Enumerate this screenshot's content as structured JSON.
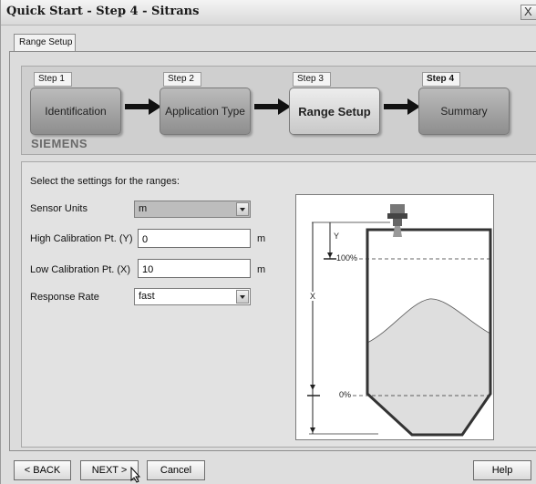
{
  "window": {
    "title": "Quick Start - Step 4 - Sitrans",
    "close_glyph": "X"
  },
  "tabs": [
    {
      "label": "Range Setup"
    }
  ],
  "wizard": {
    "steps": [
      {
        "label": "Step 1",
        "name": "Identification"
      },
      {
        "label": "Step 2",
        "name": "Application Type"
      },
      {
        "label": "Step 3",
        "name": "Range Setup"
      },
      {
        "label": "Step 4",
        "name": "Summary"
      }
    ],
    "current_step": 3,
    "brand": "SIEMENS"
  },
  "form": {
    "instructions": "Select the settings for the ranges:",
    "sensor_units": {
      "label": "Sensor Units",
      "value": "m"
    },
    "high_cal": {
      "label": "High Calibration Pt. (Y)",
      "value": "0",
      "unit": "m"
    },
    "low_cal": {
      "label": "Low Calibration Pt. (X)",
      "value": "10",
      "unit": "m"
    },
    "response_rate": {
      "label": "Response Rate",
      "value": "fast"
    }
  },
  "diagram": {
    "y_label": "Y",
    "x_label": "X",
    "full_label": "100%",
    "empty_label": "0%"
  },
  "buttons": {
    "back": "< BACK",
    "next": "NEXT >",
    "cancel": "Cancel",
    "help": "Help"
  }
}
